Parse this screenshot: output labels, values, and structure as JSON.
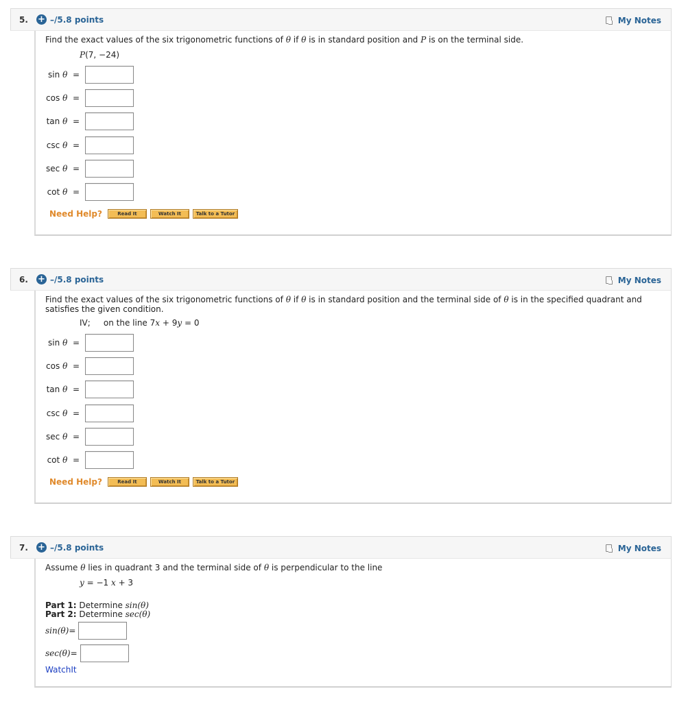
{
  "questions": [
    {
      "number": "5.",
      "points": "–/5.8 points",
      "my_notes": "My Notes",
      "prompt_parts": [
        "Find the exact values of the six trigonometric functions of ",
        "θ",
        " if ",
        "θ",
        " is in standard position and ",
        "P",
        " is on the terminal side."
      ],
      "given": {
        "p": "P",
        "rest": "(7, −24)"
      },
      "rows": [
        {
          "fn": "sin",
          "var": "θ",
          "eq": "=",
          "value": ""
        },
        {
          "fn": "cos",
          "var": "θ",
          "eq": "=",
          "value": ""
        },
        {
          "fn": "tan",
          "var": "θ",
          "eq": "=",
          "value": ""
        },
        {
          "fn": "csc",
          "var": "θ",
          "eq": "=",
          "value": ""
        },
        {
          "fn": "sec",
          "var": "θ",
          "eq": "=",
          "value": ""
        },
        {
          "fn": "cot",
          "var": "θ",
          "eq": "=",
          "value": ""
        }
      ],
      "need_help": "Need Help?",
      "help_buttons": [
        "Read It",
        "Watch It",
        "Talk to a Tutor"
      ]
    },
    {
      "number": "6.",
      "points": "–/5.8 points",
      "my_notes": "My Notes",
      "prompt_parts": [
        "Find the exact values of the six trigonometric functions of ",
        "θ",
        " if ",
        "θ",
        " is in standard position and the terminal side of ",
        "θ",
        " is in the specified quadrant and satisfies the given condition."
      ],
      "given": {
        "quadrant": "IV;",
        "pre": "on the line 7",
        "x": "x",
        "mid": " + 9",
        "y": "y",
        "post": " = 0"
      },
      "rows": [
        {
          "fn": "sin",
          "var": "θ",
          "eq": "=",
          "value": ""
        },
        {
          "fn": "cos",
          "var": "θ",
          "eq": "=",
          "value": ""
        },
        {
          "fn": "tan",
          "var": "θ",
          "eq": "=",
          "value": ""
        },
        {
          "fn": "csc",
          "var": "θ",
          "eq": "=",
          "value": ""
        },
        {
          "fn": "sec",
          "var": "θ",
          "eq": "=",
          "value": ""
        },
        {
          "fn": "cot",
          "var": "θ",
          "eq": "=",
          "value": ""
        }
      ],
      "need_help": "Need Help?",
      "help_buttons": [
        "Read It",
        "Watch It",
        "Talk to a Tutor"
      ]
    },
    {
      "number": "7.",
      "points": "–/5.8 points",
      "my_notes": "My Notes",
      "prompt_parts": [
        "Assume ",
        "θ",
        " lies in quadrant 3 and the terminal side of ",
        "θ",
        " is perpendicular to the line"
      ],
      "given": {
        "y": "y",
        "eq": " = −1 ",
        "x": "x",
        "rest": " + 3"
      },
      "parts": [
        {
          "label": "Part 1:",
          "text": " Determine ",
          "expr": "sin(θ)"
        },
        {
          "label": "Part 2:",
          "text": " Determine ",
          "expr": "sec(θ)"
        }
      ],
      "answers": [
        {
          "expr": "sin(θ)",
          "eq": " =",
          "value": ""
        },
        {
          "expr": "sec(θ)",
          "eq": " =",
          "value": ""
        }
      ],
      "watchit": "WatchIt"
    }
  ]
}
